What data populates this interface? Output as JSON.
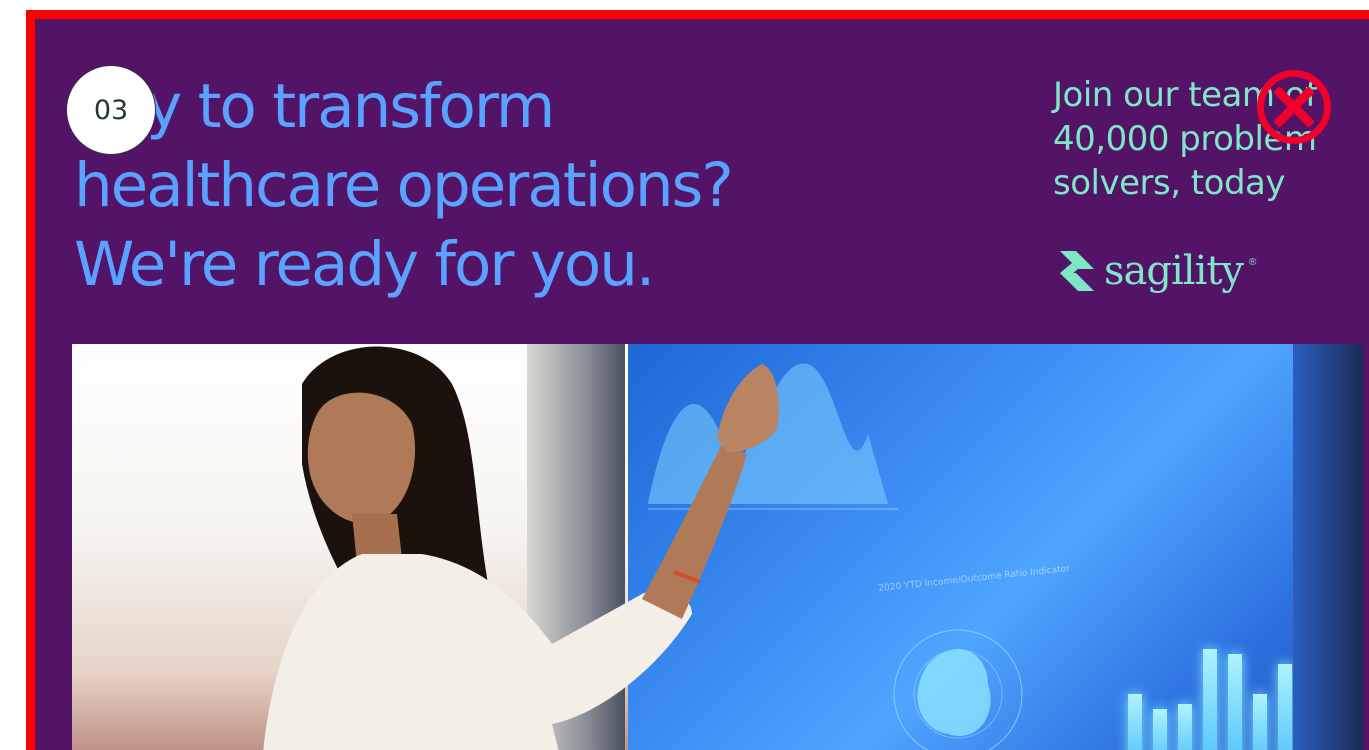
{
  "headline": {
    "line1": "ady to transform",
    "line2": "healthcare operations?",
    "line3": "We're ready for you."
  },
  "step_badge": "03",
  "cta": {
    "line1": "Join our team of",
    "line2": "40,000 problem",
    "line3": "solvers, today"
  },
  "brand": {
    "name": "sagility",
    "registered_mark": "®",
    "icon": "sagility-logo-icon"
  },
  "close_icon": "close-x-icon",
  "colors": {
    "background": "#531366",
    "headline": "#5aa2ff",
    "accent_mint": "#7ee7c6",
    "frame_border": "#ff0000",
    "close": "#f0002a"
  },
  "hero_image": {
    "chart_label": "2020 YTD Income/Outcome Ratio Indicator"
  }
}
